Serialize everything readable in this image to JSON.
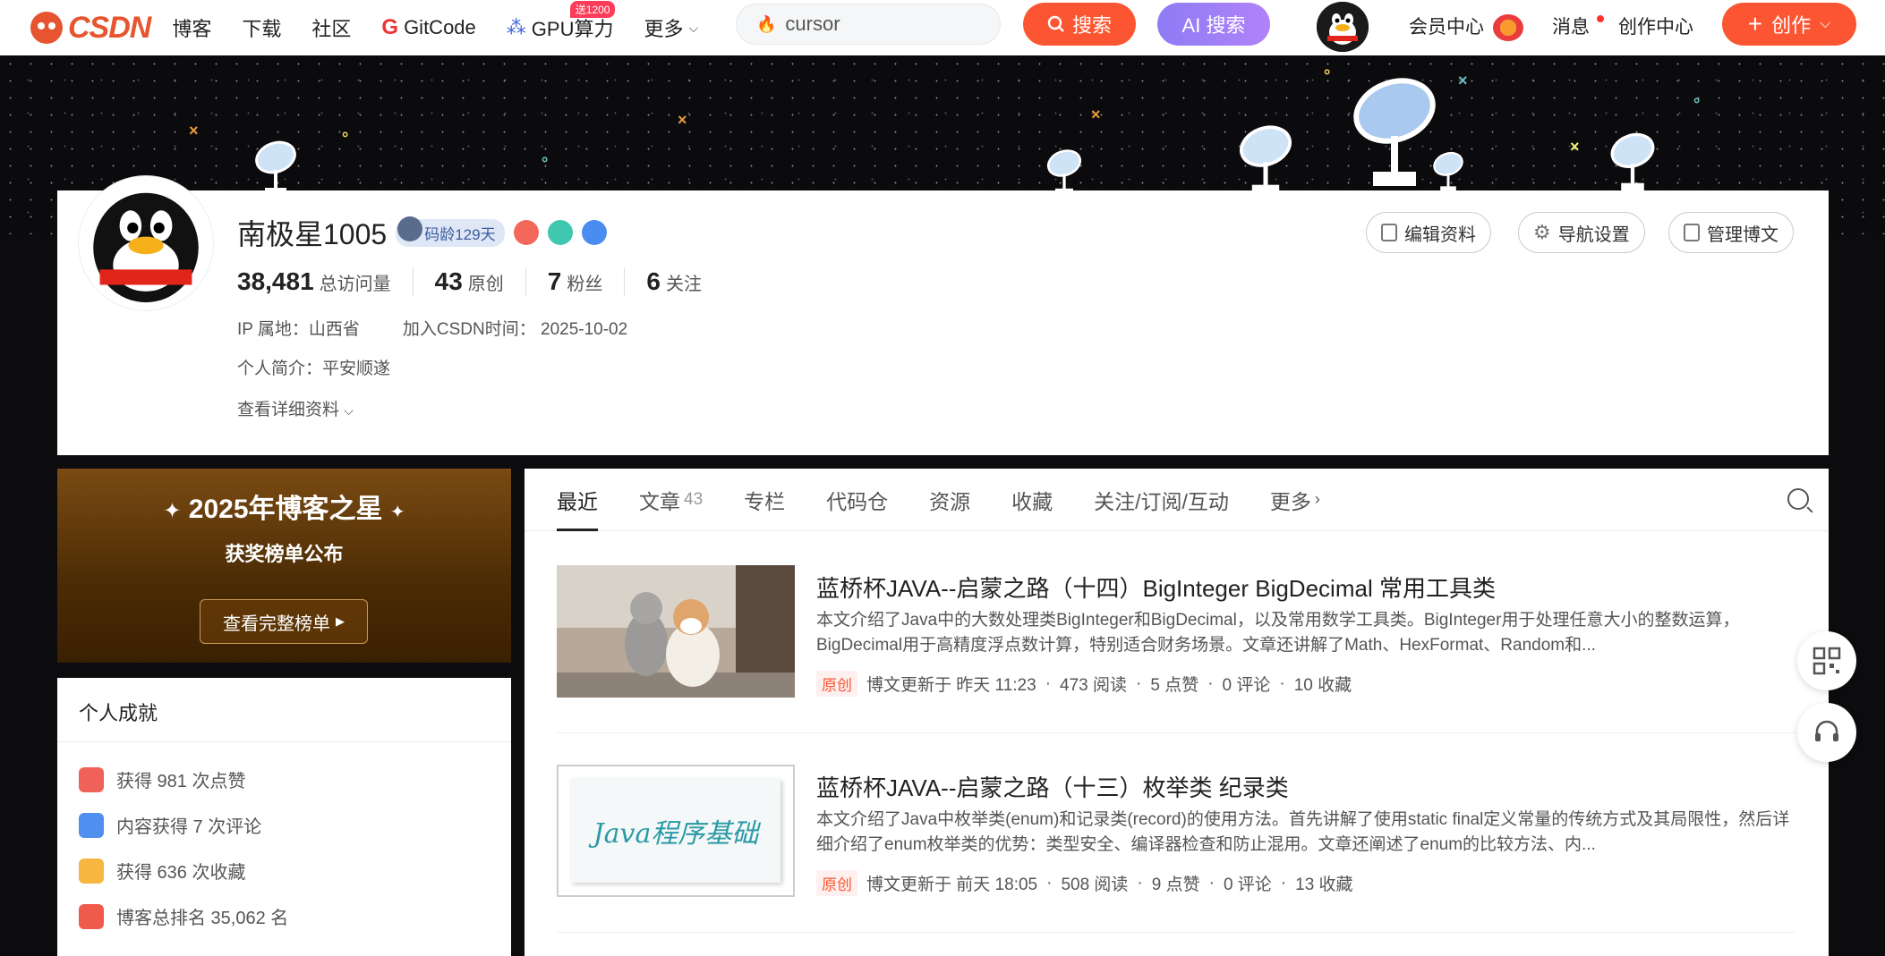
{
  "nav": {
    "logo": "CSDN",
    "links": [
      "博客",
      "下载",
      "社区"
    ],
    "gitcode": "GitCode",
    "gpu": "GPU算力",
    "gpu_badge": "送1200",
    "more": "更多",
    "search_value": "cursor",
    "search_btn": "搜索",
    "ai_search_btn": "AI 搜索",
    "vip": "会员中心",
    "messages": "消息",
    "creation_center": "创作中心",
    "create_btn": "创作"
  },
  "profile": {
    "name": "南极星1005",
    "code_age": "码龄129天",
    "stats": [
      {
        "num": "38,481",
        "label": "总访问量"
      },
      {
        "num": "43",
        "label": "原创"
      },
      {
        "num": "7",
        "label": "粉丝"
      },
      {
        "num": "6",
        "label": "关注"
      }
    ],
    "ip": "IP 属地：山西省",
    "joined": "加入CSDN时间：  2025-10-02",
    "bio": "个人简介：平安顺遂",
    "more": "查看详细资料",
    "buttons": [
      "编辑资料",
      "导航设置",
      "管理博文"
    ]
  },
  "award": {
    "title": "2025年博客之星",
    "subtitle": "获奖榜单公布",
    "button": "查看完整榜单"
  },
  "achievements": {
    "title": "个人成就",
    "items": [
      "获得 981 次点赞",
      "内容获得 7 次评论",
      "获得 636 次收藏",
      "博客总排名 35,062 名"
    ]
  },
  "tabs": [
    {
      "label": "最近",
      "count": ""
    },
    {
      "label": "文章",
      "count": "43"
    },
    {
      "label": "专栏",
      "count": ""
    },
    {
      "label": "代码仓",
      "count": ""
    },
    {
      "label": "资源",
      "count": ""
    },
    {
      "label": "收藏",
      "count": ""
    },
    {
      "label": "关注/订阅/互动",
      "count": ""
    },
    {
      "label": "更多",
      "count": ""
    }
  ],
  "posts": [
    {
      "title": "蓝桥杯JAVA--启蒙之路（十四）BigInteger BigDecimal 常用工具类",
      "desc": "本文介绍了Java中的大数处理类BigInteger和BigDecimal，以及常用数学工具类。BigInteger用于处理任意大小的整数运算，BigDecimal用于高精度浮点数计算，特别适合财务场景。文章还讲解了Math、HexFormat、Random和...",
      "tag": "原创",
      "updated": "博文更新于 昨天 11:23",
      "reads": "473 阅读",
      "likes": "5 点赞",
      "comments": "0 评论",
      "favs": "10 收藏"
    },
    {
      "title": "蓝桥杯JAVA--启蒙之路（十三）枚举类 纪录类",
      "desc": "本文介绍了Java中枚举类(enum)和记录类(record)的使用方法。首先讲解了使用static final定义常量的传统方式及其局限性，然后详细介绍了enum枚举类的优势：类型安全、编译器检查和防止混用。文章还阐述了enum的比较方法、内...",
      "thumb_text": "Java程序基础",
      "tag": "原创",
      "updated": "博文更新于 前天 18:05",
      "reads": "508 阅读",
      "likes": "9 点赞",
      "comments": "0 评论",
      "favs": "13 收藏"
    }
  ],
  "colors": {
    "accent": "#fc5531",
    "ai": "#9a7ff6",
    "banner": "#0c0c0e"
  }
}
